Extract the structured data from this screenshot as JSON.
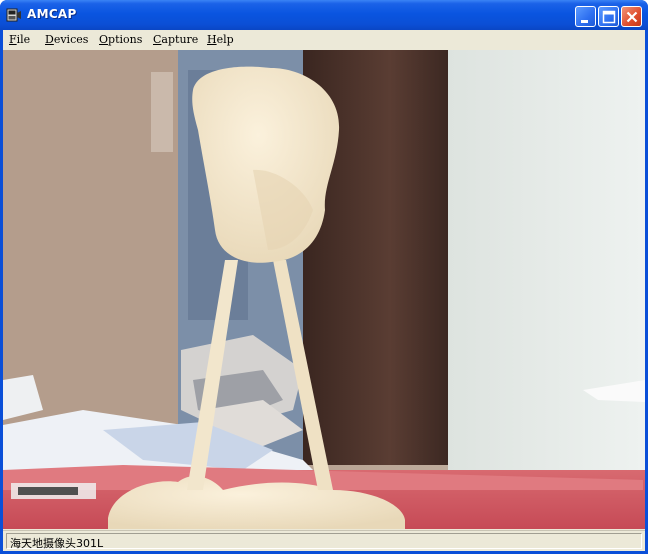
{
  "window": {
    "title": "AMCAP",
    "accent_color": "#0a55e0",
    "close_color": "#df4c2c"
  },
  "icons": {
    "app": "camera-app-icon",
    "minimize": "minimize-icon",
    "maximize": "maximize-icon",
    "close": "close-icon"
  },
  "menu": {
    "items": [
      {
        "accel": "F",
        "rest": "ile"
      },
      {
        "accel": "D",
        "rest": "evices"
      },
      {
        "accel": "O",
        "rest": "ptions"
      },
      {
        "accel": "C",
        "rest": "apture"
      },
      {
        "accel": "H",
        "rest": "elp"
      }
    ]
  },
  "status": {
    "device_name": "海天地摄像头301L"
  }
}
